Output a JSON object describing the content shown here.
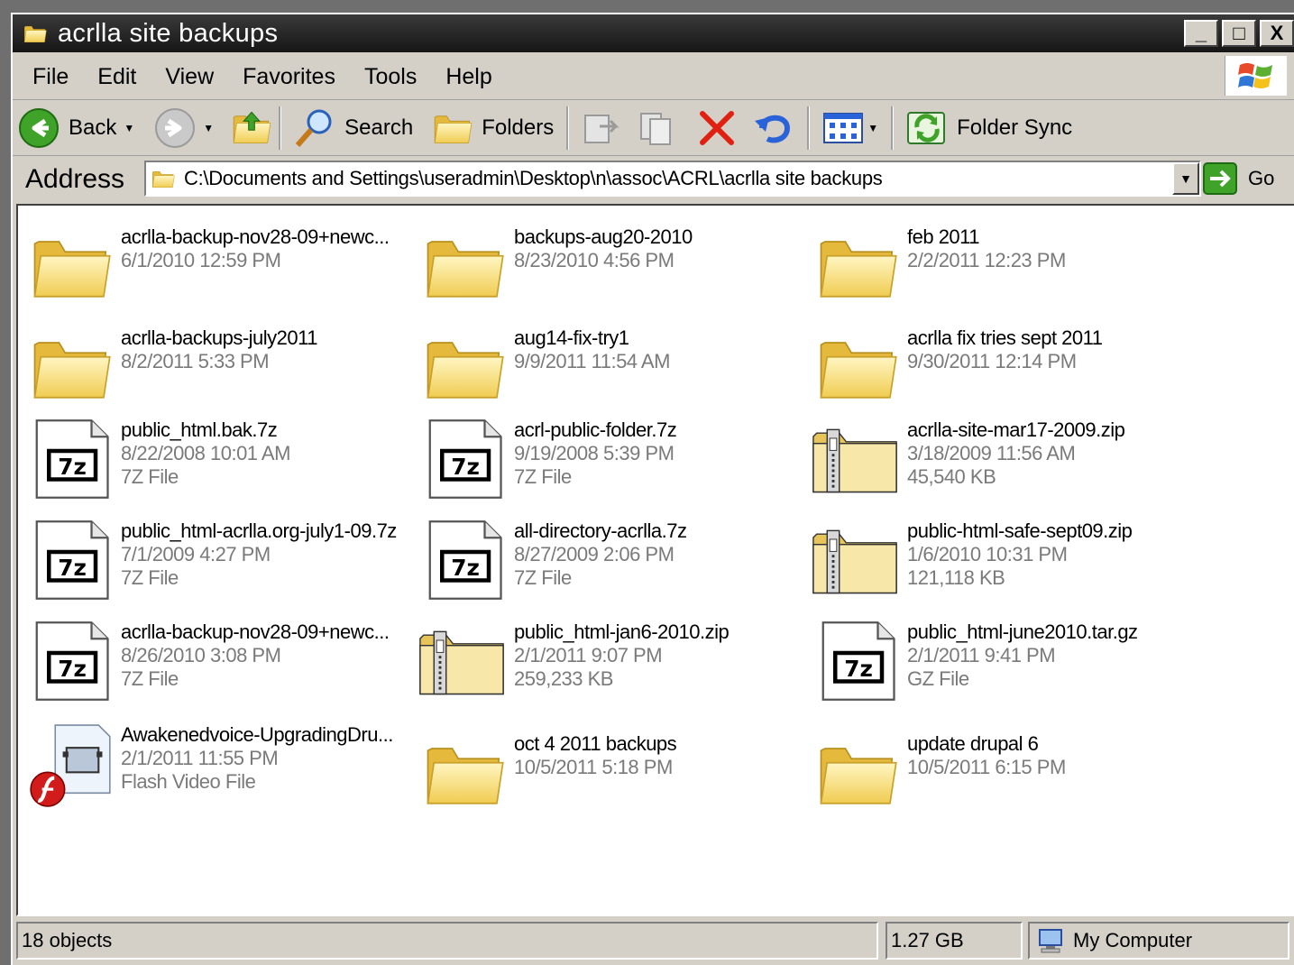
{
  "window": {
    "title": "acrlla site backups"
  },
  "title_buttons": [
    "_",
    "□",
    "X"
  ],
  "menu": [
    "File",
    "Edit",
    "View",
    "Favorites",
    "Tools",
    "Help"
  ],
  "toolbar": {
    "back": "Back",
    "search": "Search",
    "folders": "Folders",
    "folder_sync": "Folder Sync"
  },
  "address": {
    "label": "Address",
    "path": "C:\\Documents and Settings\\useradmin\\Desktop\\n\\assoc\\ACRL\\acrlla site backups",
    "go": "Go"
  },
  "items": [
    {
      "name": "acrlla-backup-nov28-09+newc...",
      "line2": "6/1/2010 12:59 PM",
      "line3": "",
      "icon": "folder"
    },
    {
      "name": "backups-aug20-2010",
      "line2": "8/23/2010 4:56 PM",
      "line3": "",
      "icon": "folder"
    },
    {
      "name": "feb 2011",
      "line2": "2/2/2011 12:23 PM",
      "line3": "",
      "icon": "folder"
    },
    {
      "name": "acrlla-backups-july2011",
      "line2": "8/2/2011 5:33 PM",
      "line3": "",
      "icon": "folder"
    },
    {
      "name": "aug14-fix-try1",
      "line2": "9/9/2011 11:54 AM",
      "line3": "",
      "icon": "folder"
    },
    {
      "name": "acrlla fix tries sept 2011",
      "line2": "9/30/2011 12:14 PM",
      "line3": "",
      "icon": "folder"
    },
    {
      "name": "public_html.bak.7z",
      "line2": "8/22/2008 10:01 AM",
      "line3": "7Z File",
      "icon": "7z"
    },
    {
      "name": "acrl-public-folder.7z",
      "line2": "9/19/2008 5:39 PM",
      "line3": "7Z File",
      "icon": "7z"
    },
    {
      "name": "acrlla-site-mar17-2009.zip",
      "line2": "3/18/2009 11:56 AM",
      "line3": "45,540 KB",
      "icon": "zip"
    },
    {
      "name": "public_html-acrlla.org-july1-09.7z",
      "line2": "7/1/2009 4:27 PM",
      "line3": "7Z File",
      "icon": "7z"
    },
    {
      "name": "all-directory-acrlla.7z",
      "line2": "8/27/2009 2:06 PM",
      "line3": "7Z File",
      "icon": "7z"
    },
    {
      "name": "public-html-safe-sept09.zip",
      "line2": "1/6/2010 10:31 PM",
      "line3": "121,118 KB",
      "icon": "zip"
    },
    {
      "name": "acrlla-backup-nov28-09+newc...",
      "line2": "8/26/2010 3:08 PM",
      "line3": "7Z File",
      "icon": "7z"
    },
    {
      "name": "public_html-jan6-2010.zip",
      "line2": "2/1/2011 9:07 PM",
      "line3": "259,233 KB",
      "icon": "zip"
    },
    {
      "name": "public_html-june2010.tar.gz",
      "line2": "2/1/2011 9:41 PM",
      "line3": "GZ File",
      "icon": "7z"
    },
    {
      "name": "Awakenedvoice-UpgradingDru...",
      "line2": "2/1/2011 11:55 PM",
      "line3": "Flash Video File",
      "icon": "flash"
    },
    {
      "name": "oct 4 2011 backups",
      "line2": "10/5/2011 5:18 PM",
      "line3": "",
      "icon": "folder"
    },
    {
      "name": "update drupal 6",
      "line2": "10/5/2011 6:15 PM",
      "line3": "",
      "icon": "folder"
    }
  ],
  "status": {
    "objects": "18 objects",
    "size": "1.27 GB",
    "zone": "My Computer"
  }
}
